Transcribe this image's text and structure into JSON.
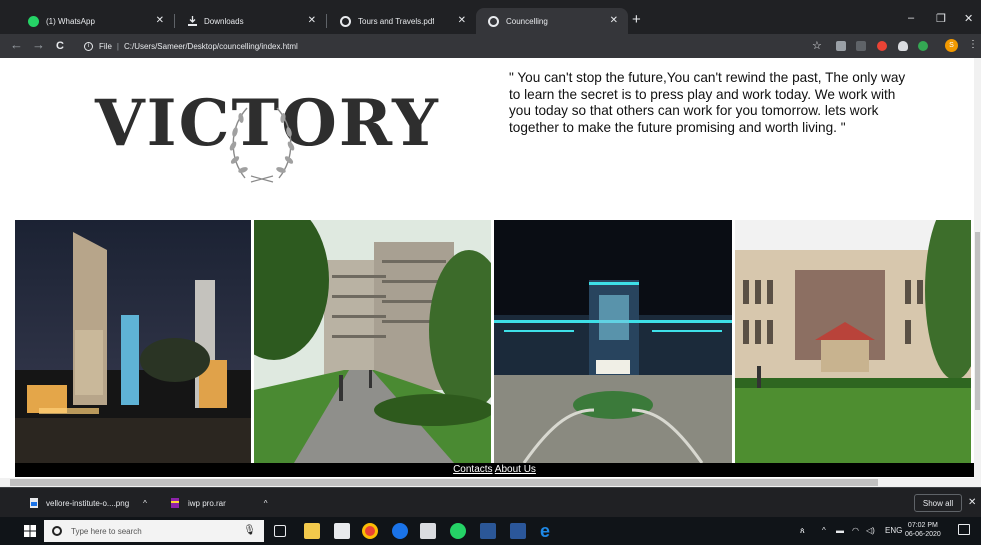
{
  "browser": {
    "tabs": [
      {
        "label": "(1) WhatsApp",
        "icon": "whatsapp-icon",
        "icon_color": "#25d366",
        "active": false
      },
      {
        "label": "Downloads",
        "icon": "download-icon",
        "icon_color": "#e8eaed",
        "active": false
      },
      {
        "label": "Tours and Travels.pdf",
        "icon": "globe-icon",
        "icon_color": "#e8eaed",
        "active": false
      },
      {
        "label": "Councelling",
        "icon": "globe-icon",
        "icon_color": "#e8eaed",
        "active": true
      }
    ],
    "new_tab": "+",
    "window_controls": {
      "minimize": "–",
      "maximize": "❐",
      "close": "✕"
    },
    "nav": {
      "back": "←",
      "forward": "→",
      "reload": "C"
    },
    "address": {
      "scheme": "File",
      "url": "C:/Users/Sameer/Desktop/councelling/index.html"
    },
    "profile_initial": "S",
    "menu": "⋮"
  },
  "page": {
    "logo_text": "VICTORY",
    "quote": "\" You can't stop the future,You can't rewind the past, The only way to learn the secret is to press play and work today. We work with you today so that others can work for you tomorrow. lets work together to make the future promising and worth living. \"",
    "footer": {
      "contacts": "Contacts",
      "about": "About Us"
    }
  },
  "downloads": [
    {
      "name": "vellore-institute-o....png",
      "icon": "image-file-icon"
    },
    {
      "name": "iwp pro.rar",
      "icon": "archive-file-icon"
    }
  ],
  "shelf": {
    "show_all": "Show all",
    "close": "✕"
  },
  "taskbar": {
    "search_placeholder": "Type here to search",
    "tray": {
      "lang": "ENG"
    },
    "time": "07:02 PM",
    "date": "06-06-2020"
  },
  "colors": {
    "chrome_dark": "#202124",
    "toolbar": "#35363a",
    "taskbar": "#101418",
    "footer_bar": "#000000"
  }
}
